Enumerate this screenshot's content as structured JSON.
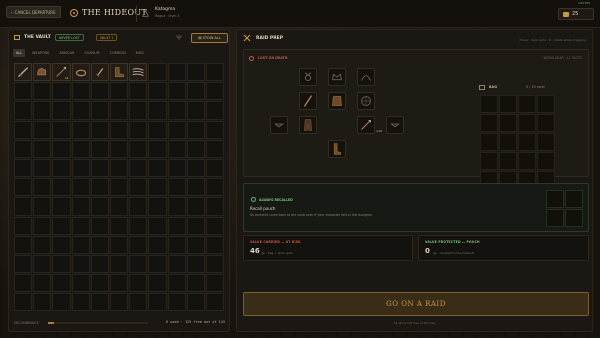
{
  "app": {
    "title": "THE HIDEOUT",
    "latency": "144 FPS"
  },
  "header": {
    "cancel_label": "CANCEL DEPARTURE",
    "character_name": "Katagma",
    "character_sub": "Rogue · level 3",
    "gold": "25"
  },
  "vault": {
    "title": "THE VAULT",
    "badge_green": "NEVER LOST",
    "badge_gold": "VAULT 1",
    "stow_label": "STOW ALL",
    "filters": [
      "ALL",
      "WEAPONS",
      "ARMOUR",
      "CONSUM",
      "COMMON",
      "MISC"
    ],
    "active_filter": "ALL",
    "items": [
      {
        "icon": "sword-icon",
        "qty": ""
      },
      {
        "icon": "gloves-icon",
        "qty": ""
      },
      {
        "icon": "arrow-icon",
        "qty": "x4"
      },
      {
        "icon": "rope-icon",
        "qty": ""
      },
      {
        "icon": "dagger-icon",
        "qty": ""
      },
      {
        "icon": "boots-icon",
        "qty": ""
      },
      {
        "icon": "claws-icon",
        "qty": ""
      }
    ],
    "encumbrance_label": "ENCUMBRANCE",
    "encumbrance_fraction": 0.06,
    "capacity": "6 used · 125 free out of 143"
  },
  "raid": {
    "title": "RAID PREP",
    "hint": "Hover · item slots · R · rotate while dragging",
    "lost_label": "LOST ON DEATH",
    "worn_label": "WORN GEAR · 11 SLOTS",
    "bag_label": "BAG",
    "bag_slots": "0 / 20 slots",
    "ammo_qty": "x10",
    "pouch_label": "ALWAYS RECALLED",
    "pouch_title": "Recall pouch",
    "pouch_desc": "Its contents come back to the vault even if your character falls in the dungeon.",
    "risk_label": "VALUE CARRIED — AT RISK",
    "risk_value": "46",
    "risk_sub": "gp · bag + worn gear",
    "prot_label": "VALUE PROTECTED — POUCH",
    "prot_value": "0",
    "prot_sub": "gp · recalled to the hideout",
    "raid_button": "GO ON A RAID",
    "raid_foot": "All stock left free of the bag"
  },
  "colors": {
    "accent": "#c79b45",
    "danger": "#c45a45",
    "safe": "#7ec27e"
  }
}
